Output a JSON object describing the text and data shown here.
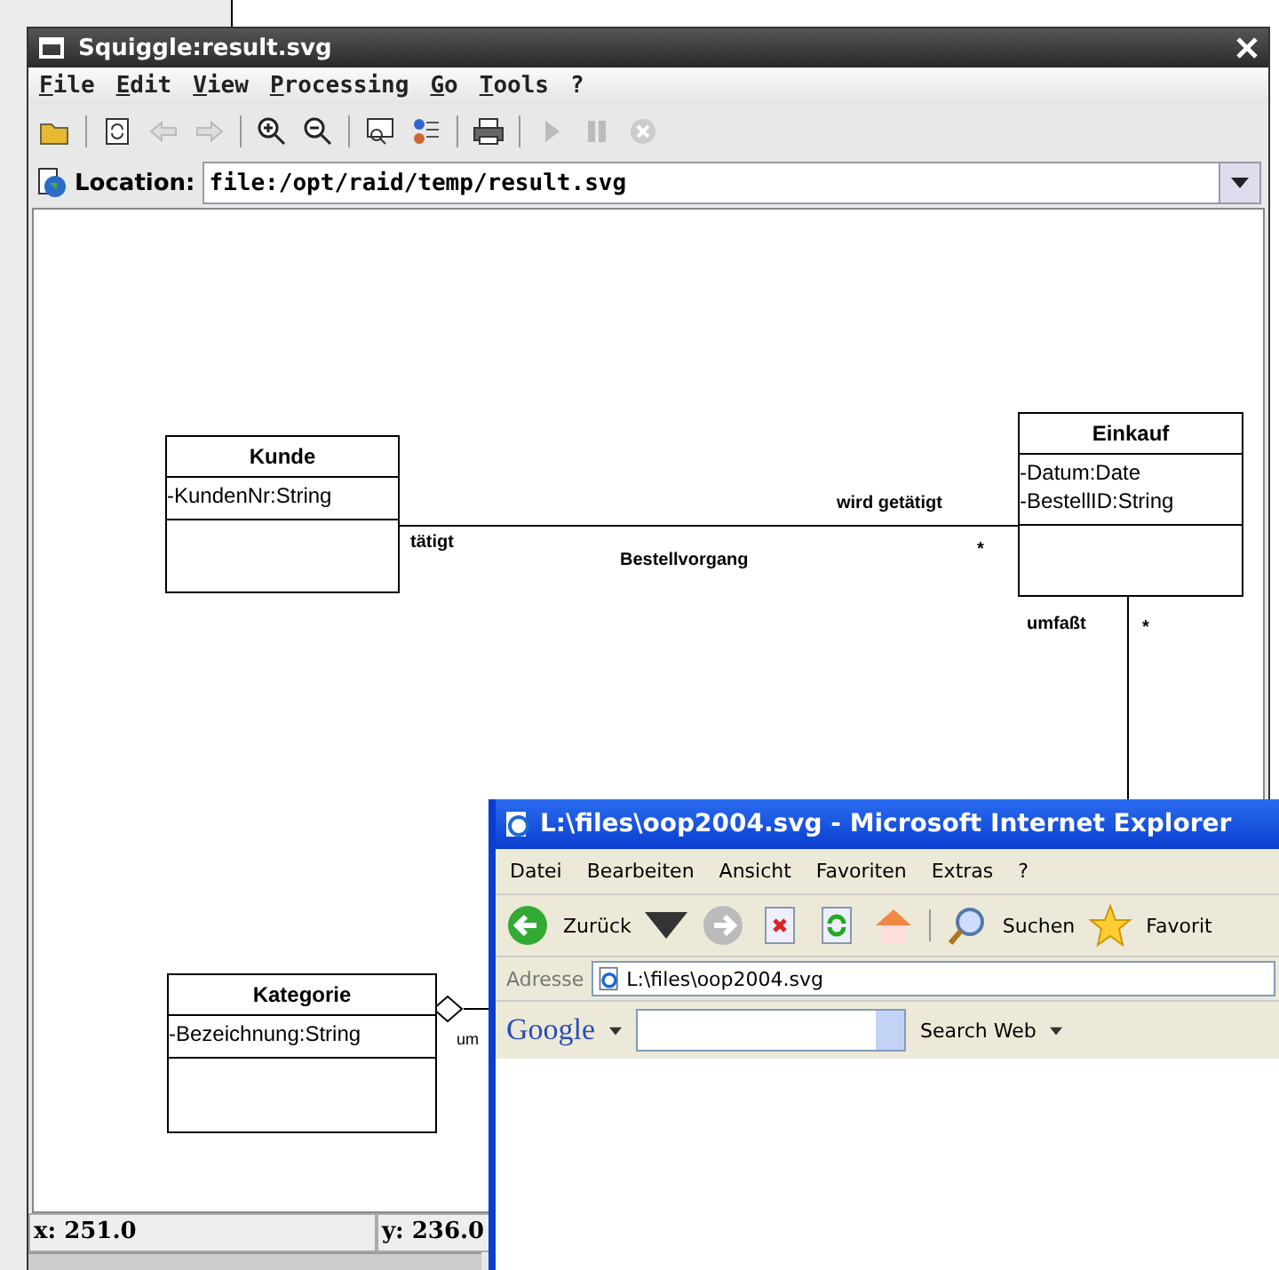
{
  "squiggle": {
    "title": "Squiggle:result.svg",
    "menu": [
      {
        "label": "File"
      },
      {
        "label": "Edit"
      },
      {
        "label": "View"
      },
      {
        "label": "Processing"
      },
      {
        "label": "Go"
      },
      {
        "label": "Tools"
      },
      {
        "label": "?"
      }
    ],
    "location": {
      "label": "Location:",
      "value": "file:/opt/raid/temp/result.svg"
    },
    "diagram": {
      "classes": [
        {
          "name": "Kunde",
          "attributes": [
            "-KundenNr:String"
          ]
        },
        {
          "name": "Einkauf",
          "attributes": [
            "-Datum:Date",
            "-BestellID:String"
          ]
        },
        {
          "name": "Kategorie",
          "attributes": [
            "-Bezeichnung:String"
          ]
        }
      ],
      "labels": [
        "wird getätigt",
        "tätigt",
        "Bestellvorgang",
        "*",
        "umfaßt",
        "*",
        "um"
      ]
    },
    "status": {
      "x": "x: 251.0",
      "y": "y: 236.0"
    }
  },
  "ie": {
    "title": "L:\\files\\oop2004.svg - Microsoft Internet Explorer",
    "menu": [
      "Datei",
      "Bearbeiten",
      "Ansicht",
      "Favoriten",
      "Extras",
      "?"
    ],
    "back": "Zurück",
    "search": "Suchen",
    "favorites": "Favorit",
    "address": {
      "label": "Adresse",
      "value": "L:\\files\\oop2004.svg"
    },
    "google": {
      "logo": "Google",
      "search_button": "Search Web"
    }
  }
}
